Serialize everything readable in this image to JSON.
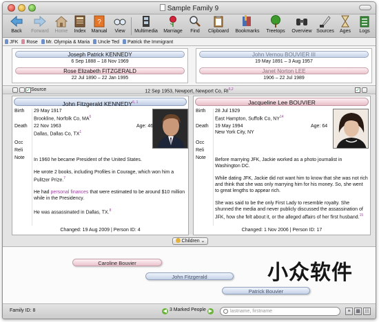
{
  "window": {
    "title": "Sample Family 9"
  },
  "toolbar": {
    "items": [
      {
        "label": "Back",
        "icon": "back-arrow-icon"
      },
      {
        "label": "Forward",
        "icon": "forward-arrow-icon"
      },
      {
        "label": "Home",
        "icon": "home-icon"
      },
      {
        "label": "Index",
        "icon": "index-book-icon"
      },
      {
        "label": "Manual",
        "icon": "manual-book-icon"
      },
      {
        "label": "View",
        "icon": "glasses-icon"
      },
      {
        "label": "Multimedia",
        "icon": "film-icon"
      },
      {
        "label": "Marriage",
        "icon": "rose-icon"
      },
      {
        "label": "Find",
        "icon": "magnifier-icon"
      },
      {
        "label": "Clipboard",
        "icon": "clipboard-icon"
      },
      {
        "label": "Bookmarks",
        "icon": "bookmarks-icon"
      },
      {
        "label": "Treetops",
        "icon": "tree-icon"
      },
      {
        "label": "Overview",
        "icon": "binoculars-icon"
      },
      {
        "label": "Sources",
        "icon": "sources-quill-icon"
      },
      {
        "label": "Ages",
        "icon": "hourglass-icon"
      },
      {
        "label": "Logs",
        "icon": "logs-icon"
      }
    ]
  },
  "bookmarks": [
    {
      "label": "JFK",
      "gender": "m"
    },
    {
      "label": "Rose",
      "gender": "f"
    },
    {
      "label": "Mr. Olympia & Maria",
      "gender": "m"
    },
    {
      "label": "Uncle Ted",
      "gender": "m"
    },
    {
      "label": "Patrick the Immigrant",
      "gender": "m"
    }
  ],
  "parents": {
    "left": {
      "father": {
        "name": "Joseph Patrick KENNEDY",
        "dates": "6 Sep 1888 – 18 Nov 1969"
      },
      "mother": {
        "name": "Rose Elizabeth FITZGERALD",
        "dates": "22 Jul 1890 – 22 Jan 1995"
      }
    },
    "right": {
      "father": {
        "name": "John Vernou BOUVIER III",
        "dates": "19 May 1891 – 3 Aug 1957"
      },
      "mother": {
        "name": "Janet Norton LEE",
        "dates": "1906 – 22 Jul 1989"
      }
    }
  },
  "source_bar": {
    "label": "Source",
    "text": "12 Sep 1953, Newport, Newport Co, RI",
    "refs": "6,2"
  },
  "husband": {
    "name": "John Fitzgerald KENNEDY",
    "name_refs": "6, 1",
    "birth_label": "Birth",
    "birth_date": "29 May 1917",
    "birth_place": "Brookline, Norfolk Co, MA",
    "birth_ref": "6",
    "death_label": "Death",
    "death_date": "22 Nov 1963",
    "death_place": "Dallas, Dallas Co, TX",
    "death_ref": "1",
    "age": "Age: 46",
    "occ_label": "Occ",
    "reli_label": "Reli",
    "note_label": "Note",
    "note_1": "In 1960 he became President of the United States.",
    "note_2": "He wrote 2 books, including Profiles in Courage, which won him a Pulitzer Prize.",
    "note_2_ref": "7",
    "note_3a": "He had ",
    "note_3_link": "personal finances",
    "note_3b": " that were estimated to be around $10 million while in the Presidency.",
    "note_4": "He was assassinated in Dallas, TX.",
    "note_4_ref": "8",
    "changed": "Changed: 19 Aug 2009 | Person ID: 4",
    "photo_icon": "jfk-portrait-photo"
  },
  "wife": {
    "name": "Jacqueline Lee BOUVIER",
    "birth_label": "Birth",
    "birth_date": "28 Jul 1929",
    "birth_place": "East Hampton, Suffolk Co, NY",
    "birth_ref": "14",
    "death_label": "Death",
    "death_date": "19 May 1994",
    "death_place": "New York City, NY",
    "age": "Age: 64",
    "occ_label": "Occ",
    "reli_label": "Reli",
    "note_label": "Note",
    "note_1": "Before marrying JFK, Jackie worked as a photo journalist in Washington DC.",
    "note_2": "While dating JFK, Jackie did not want him to know that she was not rich and think that she was only marrying him for his money. So, she went to great lengths to appear rich.",
    "note_3": "She was said to be the only First Lady to resemble royalty. She shunned the media and never publicly discussed the assassination of JFK, how she felt about it, or the alleged affairs of her first husband.",
    "note_3_ref": "15",
    "changed": "Changed: 1 Nov 2006 | Person ID: 17",
    "photo_icon": "jackie-portrait-photo"
  },
  "children_button": "Children",
  "children": [
    {
      "name": "Caroline Bouvier",
      "gender": "f"
    },
    {
      "name": "John Fitzgerald",
      "gender": "m"
    },
    {
      "name": "Patrick Bouvier",
      "gender": "m"
    }
  ],
  "watermark": "小众软件",
  "status": {
    "family_id": "Family ID: 8",
    "marked": "3 Marked People",
    "search_placeholder": "lastname, firstname"
  },
  "colors": {
    "male": "#c5d2e7",
    "female": "#ebc4cd",
    "ref_link": "#a040a0"
  }
}
